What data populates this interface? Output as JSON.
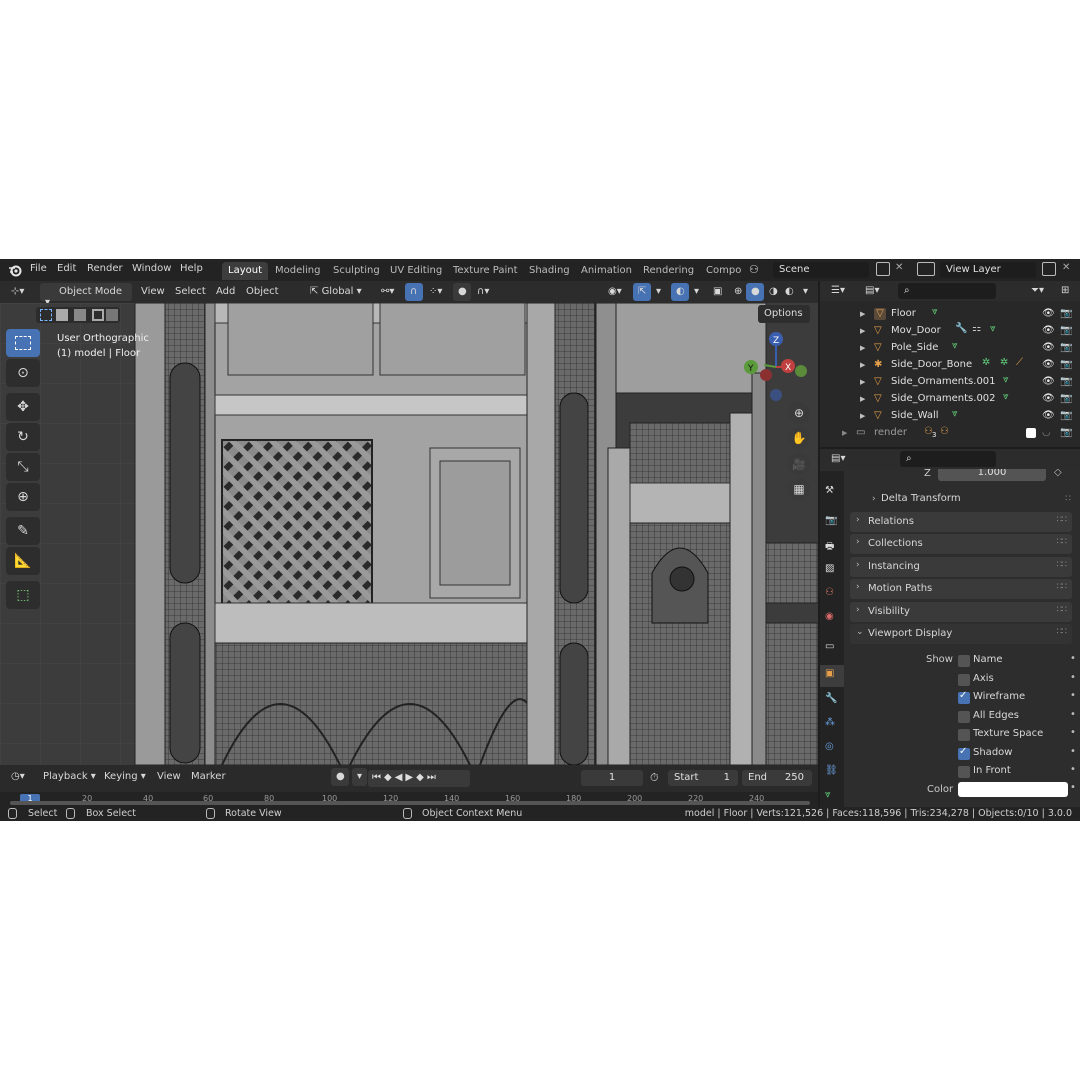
{
  "topbar": {
    "menus": [
      "File",
      "Edit",
      "Render",
      "Window",
      "Help"
    ],
    "workspaces": [
      "Layout",
      "Modeling",
      "Sculpting",
      "UV Editing",
      "Texture Paint",
      "Shading",
      "Animation",
      "Rendering",
      "Compo"
    ],
    "active_workspace": "Layout",
    "scene": "Scene",
    "view_layer": "View Layer"
  },
  "viewport_header": {
    "mode": "Object Mode",
    "menus": [
      "View",
      "Select",
      "Add",
      "Object"
    ],
    "orientation": "Global",
    "options": "Options"
  },
  "viewport": {
    "view_name": "User Orthographic",
    "context": "(1) model | Floor",
    "gizmo_axes": [
      "Z",
      "Y",
      "X"
    ]
  },
  "timeline": {
    "menus": [
      "Playback",
      "Keying",
      "View",
      "Marker"
    ],
    "current_frame": "1",
    "start_label": "Start",
    "start": "1",
    "end_label": "End",
    "end": "250",
    "ruler": [
      "1",
      "20",
      "40",
      "60",
      "80",
      "100",
      "120",
      "140",
      "160",
      "180",
      "200",
      "220",
      "240"
    ]
  },
  "outliner": {
    "items": [
      {
        "name": "Floor",
        "icon": "mesh-icon"
      },
      {
        "name": "Mov_Door",
        "icon": "mesh-icon"
      },
      {
        "name": "Pole_Side",
        "icon": "mesh-icon"
      },
      {
        "name": "Side_Door_Bone",
        "icon": "armature-icon"
      },
      {
        "name": "Side_Ornaments.001",
        "icon": "mesh-icon"
      },
      {
        "name": "Side_Ornaments.002",
        "icon": "mesh-icon"
      },
      {
        "name": "Side_Wall",
        "icon": "mesh-icon"
      }
    ],
    "collection": "render",
    "collection_count": "3"
  },
  "properties": {
    "z_label": "Z",
    "z_value": "1.000",
    "delta": "Delta Transform",
    "panels": [
      "Relations",
      "Collections",
      "Instancing",
      "Motion Paths",
      "Visibility"
    ],
    "viewport_display": "Viewport Display",
    "show_label": "Show",
    "options": [
      {
        "label": "Name",
        "checked": false
      },
      {
        "label": "Axis",
        "checked": false
      },
      {
        "label": "Wireframe",
        "checked": true
      },
      {
        "label": "All Edges",
        "checked": false
      },
      {
        "label": "Texture Space",
        "checked": false
      },
      {
        "label": "Shadow",
        "checked": true
      },
      {
        "label": "In Front",
        "checked": false
      }
    ],
    "color_label": "Color",
    "color_value": "#ffffff"
  },
  "statusbar": {
    "select": "Select",
    "box_select": "Box Select",
    "rotate": "Rotate View",
    "context_menu": "Object Context Menu",
    "stats": "model | Floor | Verts:121,526 | Faces:118,596 | Tris:234,278 | Objects:0/10 | 3.0.0"
  },
  "colors": {
    "accent": "#4772b3",
    "mesh_icon": "#e6a14a",
    "vertex_group": "#62d07a"
  }
}
